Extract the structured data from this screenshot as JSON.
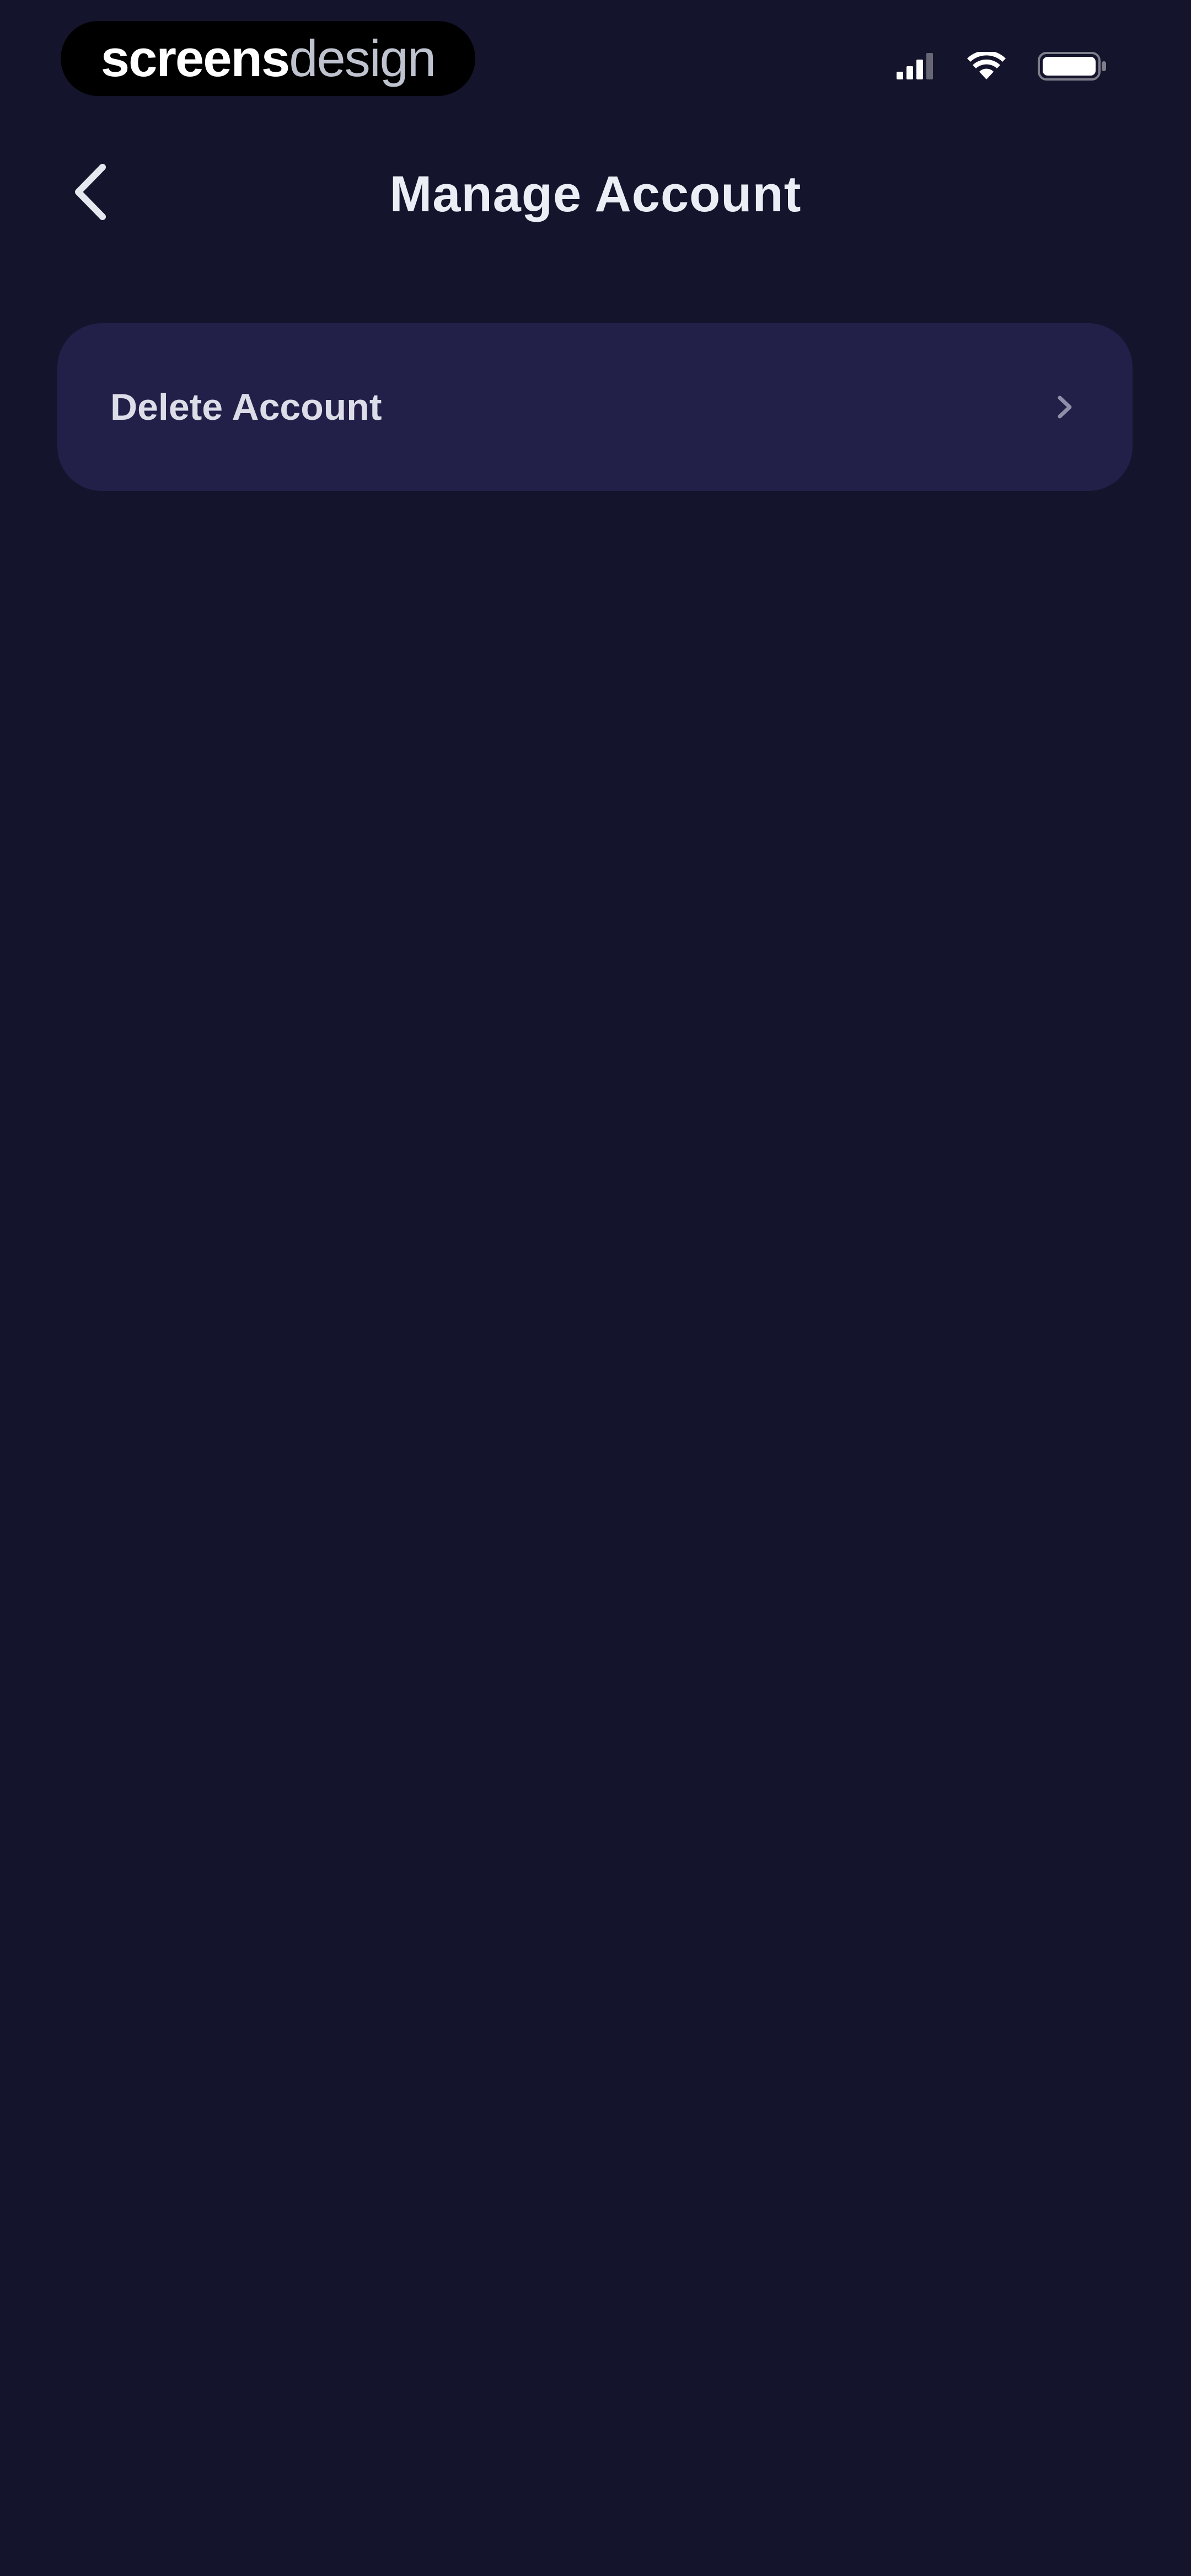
{
  "status_bar": {
    "brand": {
      "strong": "screens",
      "light": "design"
    },
    "icons": [
      "signal-icon",
      "wifi-icon",
      "battery-icon"
    ]
  },
  "header": {
    "back_icon": "chevron-left-icon",
    "title": "Manage Account"
  },
  "menu": {
    "items": [
      {
        "label": "Delete Account",
        "icon": "chevron-right-icon"
      }
    ]
  },
  "colors": {
    "background": "#14142c",
    "card": "#222048",
    "text": "#eceef5"
  }
}
